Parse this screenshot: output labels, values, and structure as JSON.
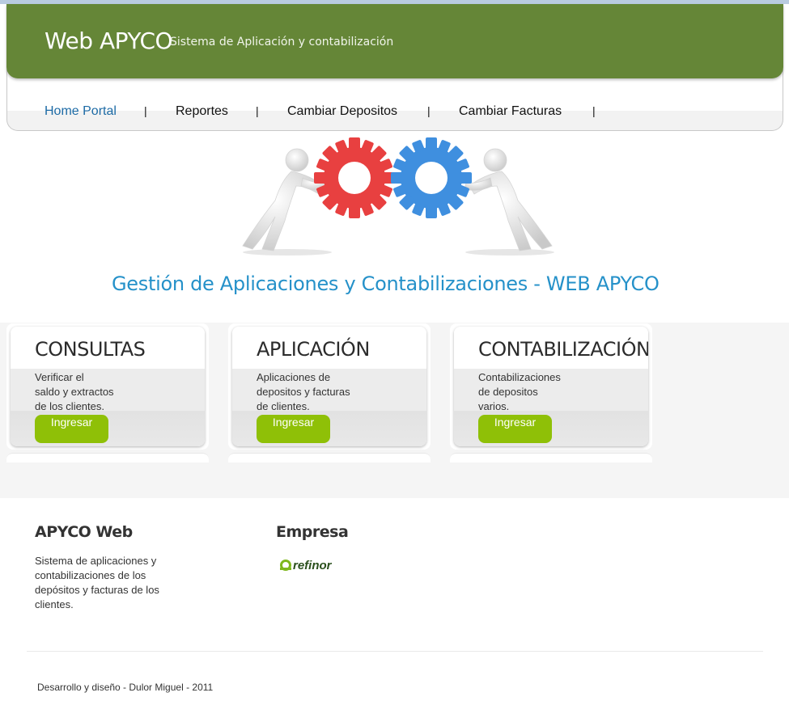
{
  "header": {
    "title": "Web APYCO",
    "subtitle": "Sistema de Aplicación y contabilización",
    "color": "#658637"
  },
  "nav": {
    "items": [
      {
        "label": "Home Portal",
        "active": true
      },
      {
        "label": "Reportes",
        "active": false
      },
      {
        "label": "Cambiar Depositos",
        "active": false
      },
      {
        "label": "Cambiar Facturas",
        "active": false
      }
    ],
    "separator": "|"
  },
  "hero": {
    "image": "two-figures-pushing-gears",
    "gear_colors": [
      "#e84040",
      "#3f8fdf"
    ],
    "tagline": "Gestión de Aplicaciones y Contabilizaciones - WEB APYCO"
  },
  "cards": [
    {
      "title": "CONSULTAS",
      "description": [
        "Verificar el",
        "saldo y extractos",
        "de los clientes."
      ],
      "button": "Ingresar"
    },
    {
      "title": "APLICACIÓN",
      "description": [
        "Aplicaciones de",
        "depositos y facturas",
        "de clientes."
      ],
      "button": "Ingresar"
    },
    {
      "title": "CONTABILIZACIÓN",
      "description": [
        "Contabilizaciones",
        "de depositos",
        "varios."
      ],
      "button": "Ingresar"
    }
  ],
  "button_color": "#8fc007",
  "footer": {
    "about_heading": "APYCO Web",
    "about_text": [
      "Sistema de aplicaciones y",
      "contabilizaciones de los",
      "depósitos y facturas de los",
      "clientes."
    ],
    "company_heading": "Empresa",
    "company_logo": "refinor",
    "credits": "Desarrollo y diseño - Dulor Miguel - 2011"
  }
}
